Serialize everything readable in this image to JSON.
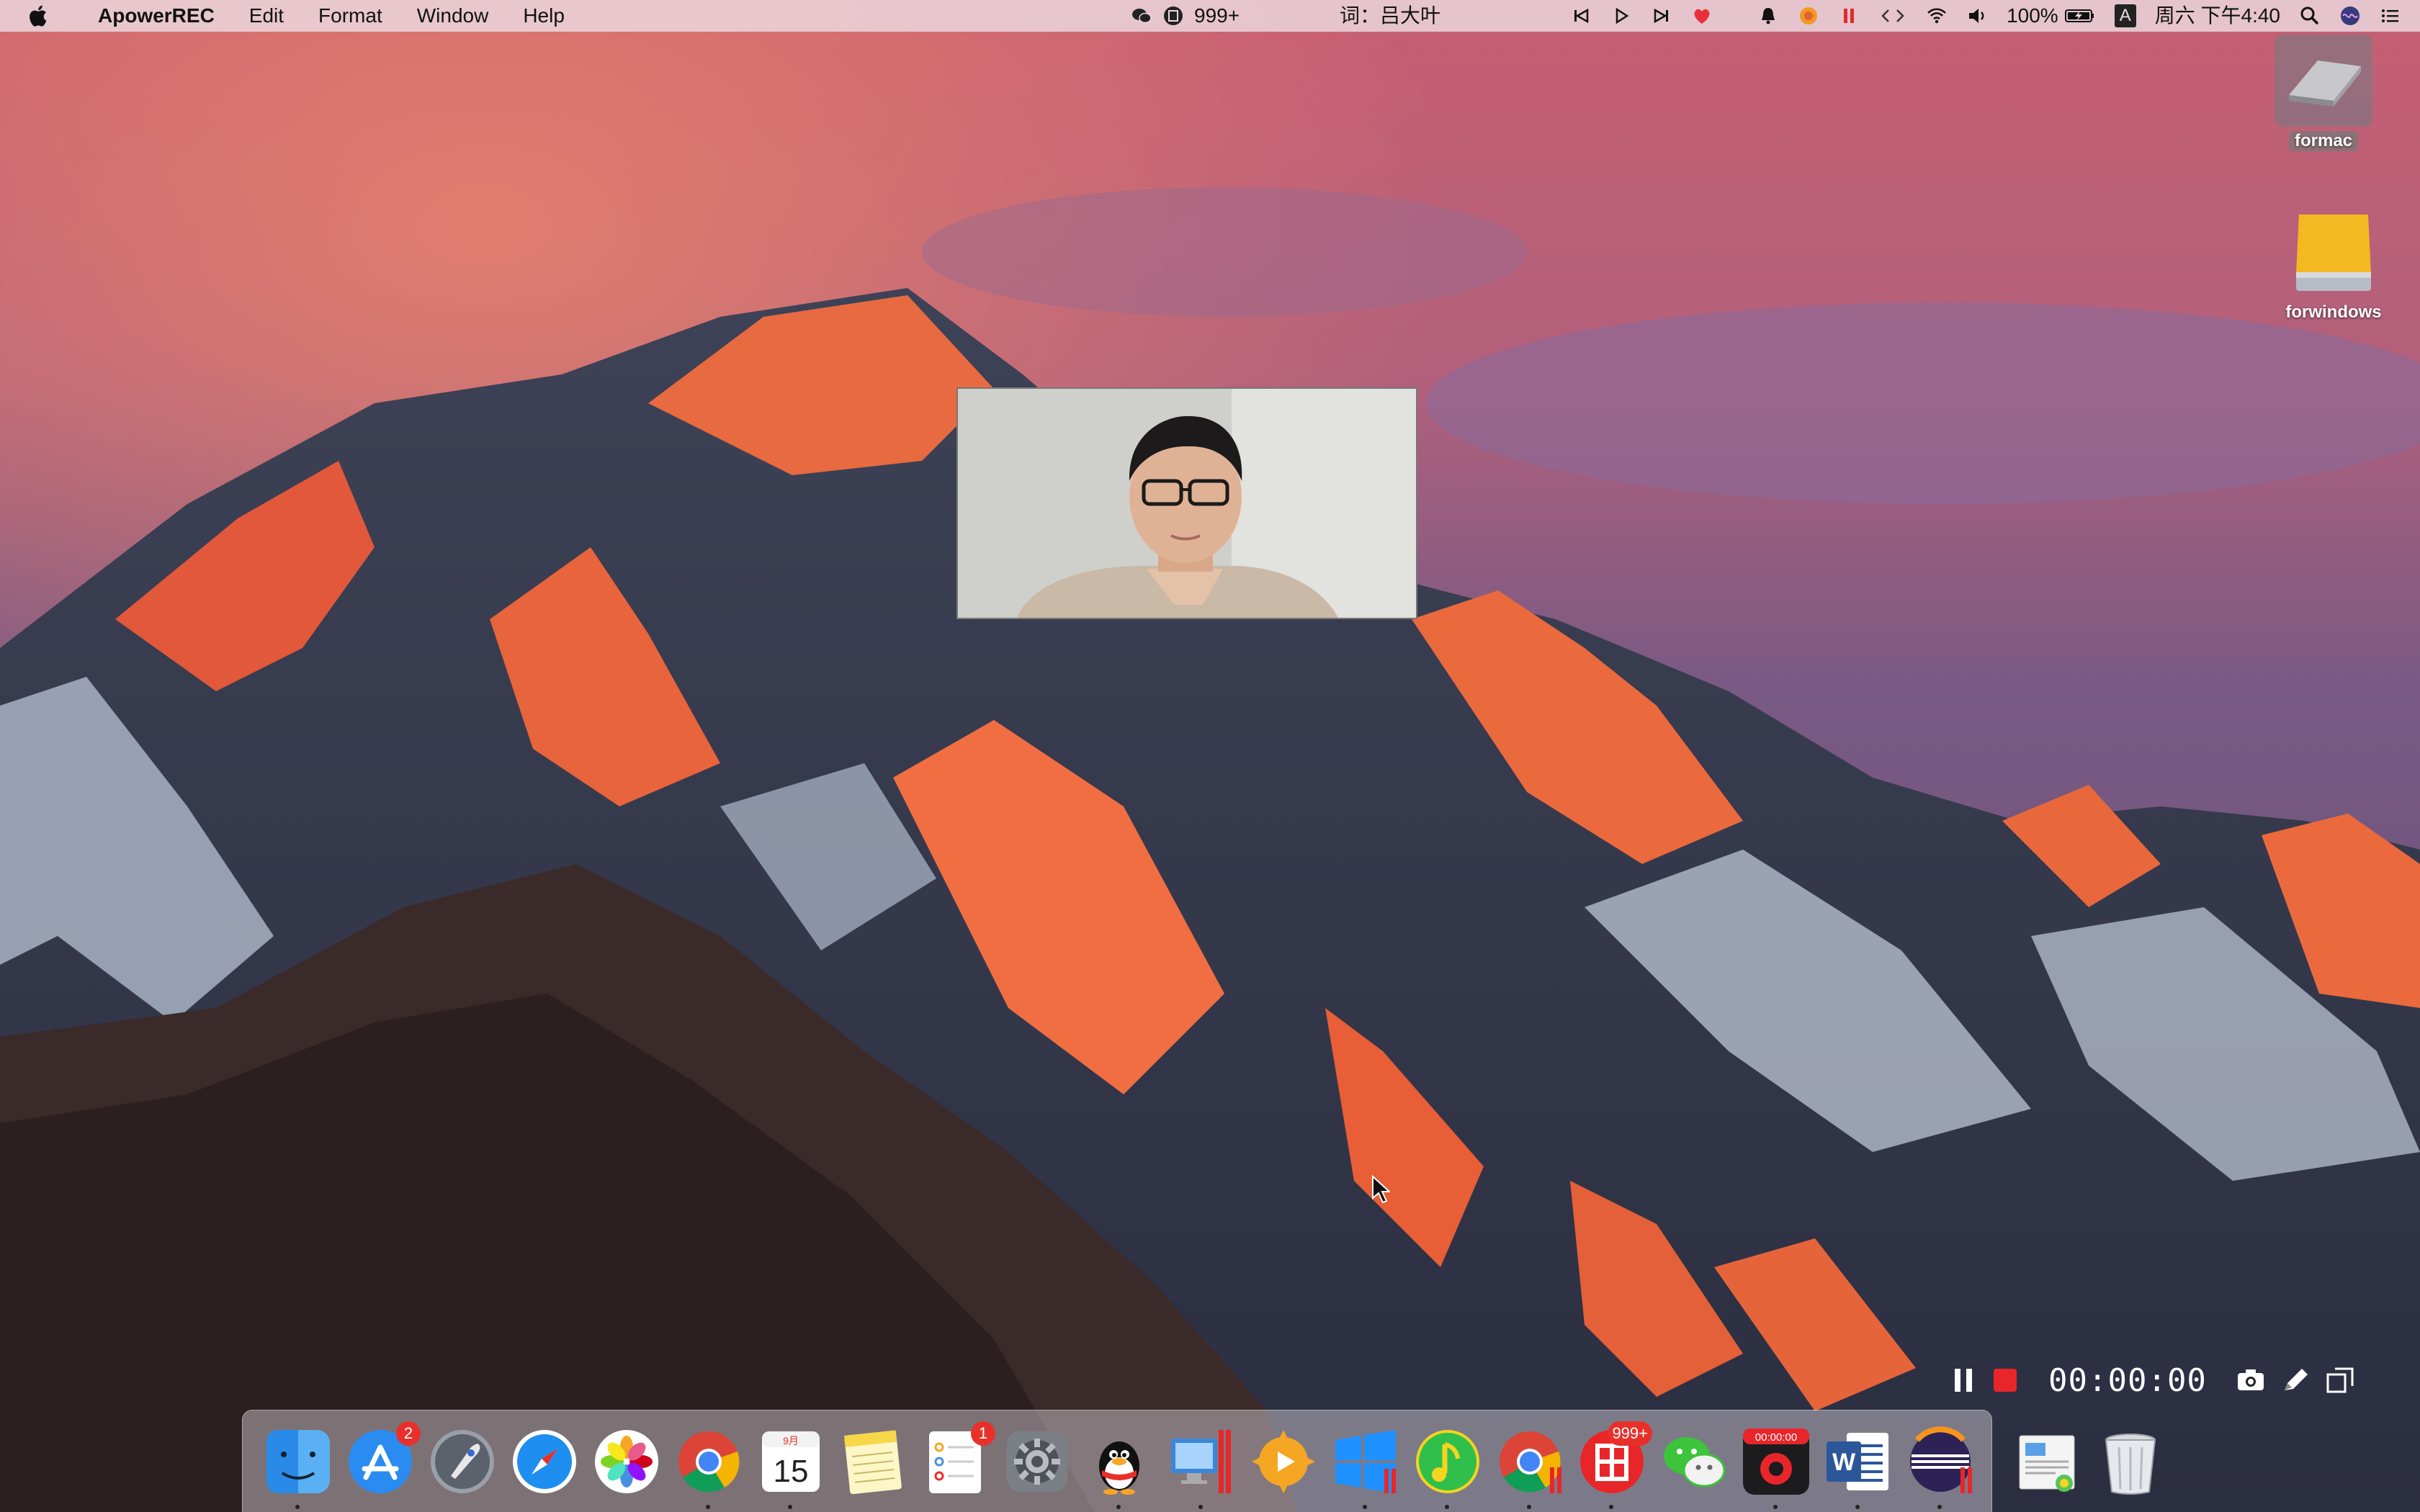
{
  "menubar": {
    "app_name": "ApowerREC",
    "menus": [
      "Edit",
      "Format",
      "Window",
      "Help"
    ],
    "center": {
      "counter": "999+",
      "lyric": "词：吕大叶"
    },
    "status": {
      "battery": "100%",
      "input_method": "A",
      "clock": "周六 下午4:40"
    }
  },
  "desktop": {
    "icons": [
      {
        "label": "formac"
      },
      {
        "label": "forwindows"
      }
    ]
  },
  "recorder": {
    "time": "00:00:00"
  },
  "dock": {
    "app_store_badge": "2",
    "calendar_month": "9月",
    "calendar_day": "15",
    "reminders_badge": "1",
    "toutiao_badge": "999+",
    "rec_timer": "00:00:00",
    "word_letter": "W"
  }
}
